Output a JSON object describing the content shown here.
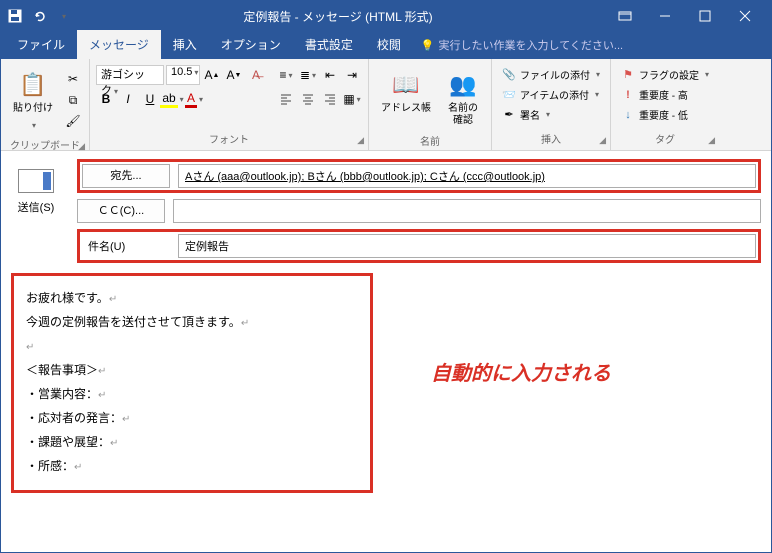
{
  "window": {
    "title": "定例報告 - メッセージ (HTML 形式)"
  },
  "tabs": {
    "file": "ファイル",
    "message": "メッセージ",
    "insert": "挿入",
    "options": "オプション",
    "format": "書式設定",
    "review": "校閲",
    "tellme": "実行したい作業を入力してください..."
  },
  "ribbon": {
    "clipboard": {
      "label": "クリップボード",
      "paste": "貼り付け"
    },
    "font": {
      "label": "フォント",
      "name": "游ゴシック",
      "size": "10.5",
      "bold": "B",
      "italic": "I",
      "underline": "U"
    },
    "names": {
      "label": "名前",
      "addressbook": "アドレス帳",
      "checknames": "名前の\n確認"
    },
    "include": {
      "label": "挿入",
      "attachfile": "ファイルの添付",
      "attachitem": "アイテムの添付",
      "signature": "署名"
    },
    "tags": {
      "label": "タグ",
      "flag": "フラグの設定",
      "importance_high": "重要度 - 高",
      "importance_low": "重要度 - 低"
    }
  },
  "compose": {
    "send": "送信(S)",
    "to_btn": "宛先...",
    "cc_btn": "ＣＣ(C)...",
    "subject_label": "件名(U)",
    "to_value": "Aさん (aaa@outlook.jp); Bさん (bbb@outlook.jp); Cさん (ccc@outlook.jp)",
    "cc_value": "",
    "subject_value": "定例報告"
  },
  "body": {
    "line1": "お疲れ様です。",
    "line2": "今週の定例報告を送付させて頂きます。",
    "heading": "＜報告事項＞",
    "item1": "・営業内容：",
    "item2": "・応対者の発言：",
    "item3": "・課題や展望：",
    "item4": "・所感："
  },
  "annotation": "自動的に入力される"
}
